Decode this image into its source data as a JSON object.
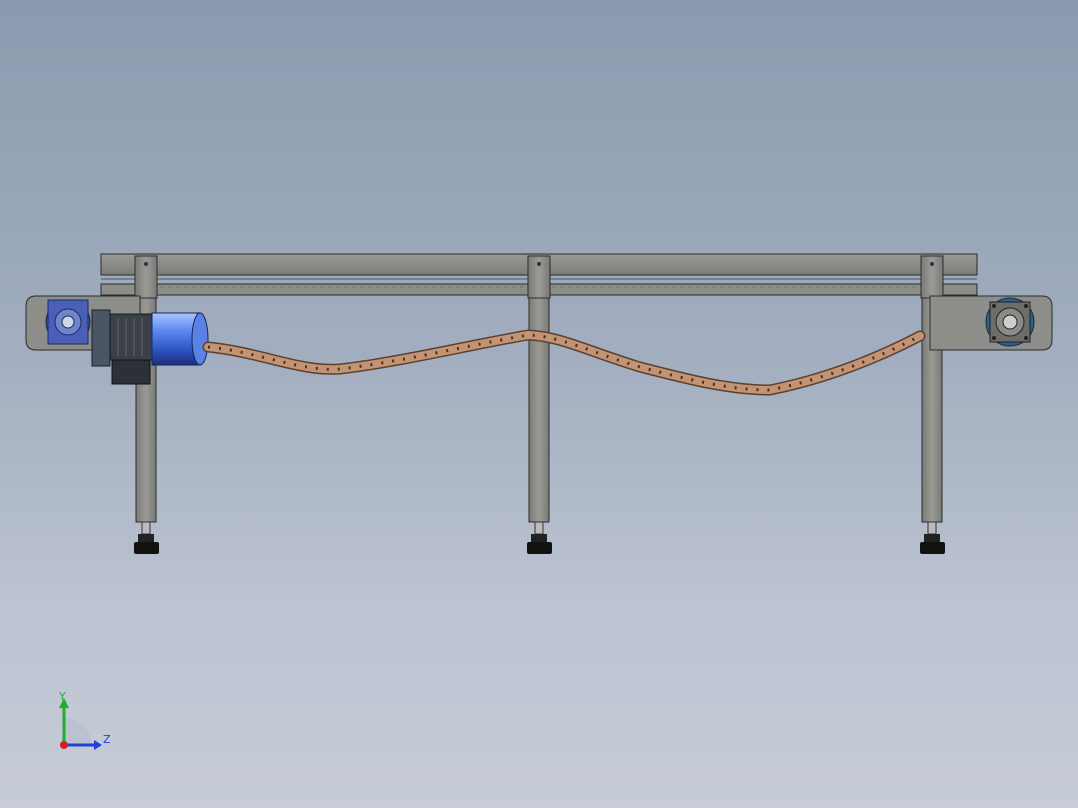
{
  "view": {
    "background_top": "#8a9aae",
    "background_bottom": "#c7ccd7"
  },
  "model": {
    "frame_color": "#8a8a86",
    "frame_outline": "#2b2b2b",
    "chain_color": "#b58a68",
    "motor_color": "#3d6fd6",
    "gearbox_color": "#4a5fb5",
    "sprocket_color": "#2f5f8a"
  },
  "triad": {
    "y_label": "Y",
    "z_label": "Z",
    "y_color": "#1fae2f",
    "z_color": "#2340d8",
    "x_color": "#d42020"
  }
}
